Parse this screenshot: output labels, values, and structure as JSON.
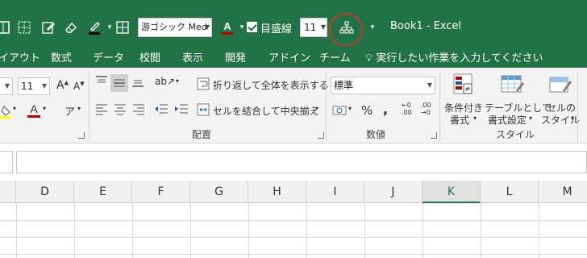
{
  "qat": {
    "font_name": "游ゴシック Med",
    "font_size": "11",
    "gridlines_label": "目盛線",
    "gridlines_checked": true,
    "title": "Book1  -  Excel"
  },
  "tabs": [
    "イアウト",
    "数式",
    "データ",
    "校閲",
    "表示",
    "開発",
    "アドイン",
    "チーム"
  ],
  "tell_me": "実行したい作業を入力してください",
  "ribbon": {
    "font_size": "11",
    "wrap_text": "折り返して全体を表示する",
    "merge_center": "セルを結合して中央揃え",
    "number_format": "標準",
    "percent": "%",
    "comma": ",",
    "group_alignment": "配置",
    "group_number": "数値",
    "group_styles": "スタイル",
    "cond_format_l1": "条件付き",
    "cond_format_l2": "書式",
    "table_format_l1": "テーブルとして",
    "table_format_l2": "書式設定",
    "cell_styles_l1": "セルの",
    "cell_styles_l2": "スタイル"
  },
  "columns": [
    "D",
    "E",
    "F",
    "G",
    "H",
    "I",
    "J",
    "K",
    "L",
    "M"
  ],
  "active_column": "K",
  "colors": {
    "excel_green": "#217346",
    "font_color_red": "#c00000",
    "highlight_yellow": "#ffff00",
    "annotation_circle": "#c0392b"
  }
}
